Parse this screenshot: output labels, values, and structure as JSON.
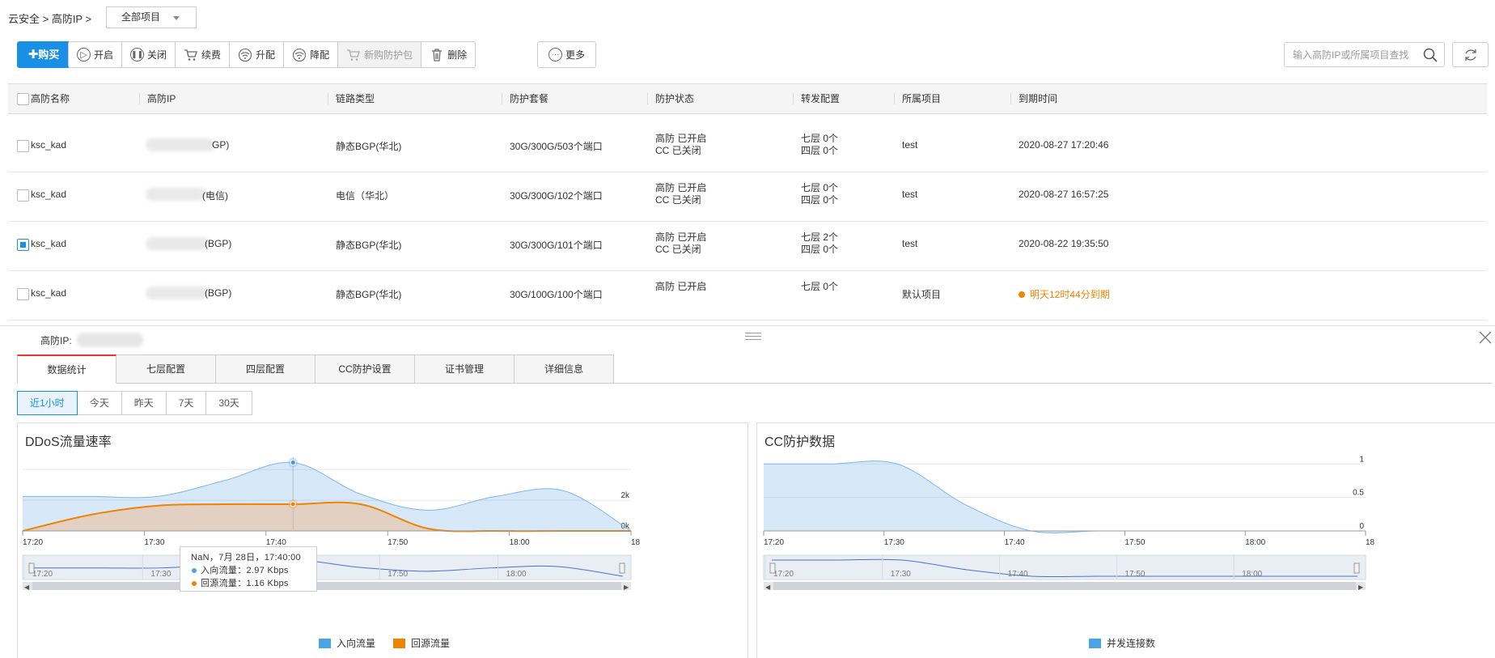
{
  "breadcrumb": "云安全 > 高防IP >",
  "project_select": "全部项目",
  "toolbar": {
    "buy": "购买",
    "group1": [
      {
        "label": "开启",
        "icon": "play-icon"
      },
      {
        "label": "关闭",
        "icon": "pause-icon"
      },
      {
        "label": "续费",
        "icon": "cart-icon"
      },
      {
        "label": "升配",
        "icon": "upgrade-icon"
      },
      {
        "label": "降配",
        "icon": "downgrade-icon"
      },
      {
        "label": "新购防护包",
        "icon": "cart-icon",
        "disabled": true
      },
      {
        "label": "删除",
        "icon": "trash-icon"
      }
    ],
    "more": "更多"
  },
  "search": {
    "placeholder": "输入高防IP或所属项目查找"
  },
  "table": {
    "headers": [
      "高防名称",
      "高防IP",
      "链路类型",
      "防护套餐",
      "防护状态",
      "转发配置",
      "所属项目",
      "到期时间"
    ],
    "rows": [
      {
        "checked": false,
        "name": "ksc_kad",
        "ip_suffix": "GP)",
        "link": "静态BGP(华北)",
        "package": "30G/300G/503个端口",
        "status1": "高防 已开启",
        "status2": "CC 已关闭",
        "fwd1": "七层 0个",
        "fwd2": "四层 0个",
        "project": "test",
        "expire": "2020-08-27 17:20:46"
      },
      {
        "checked": false,
        "name": "ksc_kad",
        "ip_suffix": "(电信)",
        "link": "电信（华北）",
        "package": "30G/300G/102个端口",
        "status1": "高防 已开启",
        "status2": "CC 已关闭",
        "fwd1": "七层 0个",
        "fwd2": "四层 0个",
        "project": "test",
        "expire": "2020-08-27 16:57:25"
      },
      {
        "checked": true,
        "name": "ksc_kad",
        "ip_suffix": "(BGP)",
        "link": "静态BGP(华北)",
        "package": "30G/300G/101个端口",
        "status1": "高防 已开启",
        "status2": "CC 已关闭",
        "fwd1": "七层 2个",
        "fwd2": "四层 0个",
        "project": "test",
        "expire": "2020-08-22 19:35:50"
      },
      {
        "checked": false,
        "name": "ksc_kad",
        "ip_suffix": "(BGP)",
        "link": "静态BGP(华北)",
        "package": "30G/100G/100个端口",
        "status1": "高防 已开启",
        "status2": "",
        "fwd1": "七层 0个",
        "fwd2": "",
        "project": "默认项目",
        "expire": "明天12时44分到期"
      }
    ]
  },
  "detail": {
    "title": "高防IP:",
    "tabs": [
      "数据统计",
      "七层配置",
      "四层配置",
      "CC防护设置",
      "证书管理",
      "详细信息"
    ],
    "ranges": [
      "近1小时",
      "今天",
      "昨天",
      "7天",
      "30天"
    ]
  },
  "charts": {
    "ddos_title": "DDoS流量速率",
    "cc_title": "CC防护数据",
    "tooltip": {
      "header": "NaN，7月 28日，17:40:00",
      "in": "入向流量：2.97 Kbps",
      "back": "回源流量：1.16 Kbps"
    },
    "ddos_legend": [
      "入向流量",
      "回源流量"
    ],
    "cc_legend": [
      "并发连接数"
    ]
  },
  "chart_data": [
    {
      "type": "area",
      "title": "DDoS流量速率",
      "x": [
        "17:20",
        "17:25",
        "17:30",
        "17:35",
        "17:40",
        "17:45",
        "17:50",
        "17:55",
        "18:00",
        "18:05"
      ],
      "x_ticks": [
        "17:20",
        "17:30",
        "17:40",
        "17:50",
        "18:00",
        "18"
      ],
      "y_ticks": [
        "0k",
        "2k"
      ],
      "ylim": [
        0,
        3200
      ],
      "series": [
        {
          "name": "入向流量",
          "color": "#7cb5ec",
          "values": [
            1500,
            1500,
            1500,
            2200,
            2970,
            1600,
            900,
            1500,
            1750,
            0
          ]
        },
        {
          "name": "回源流量",
          "color": "#f7a35c",
          "values": [
            0,
            700,
            1100,
            1160,
            1160,
            1160,
            100,
            0,
            0,
            0
          ]
        }
      ]
    },
    {
      "type": "area",
      "title": "CC防护数据",
      "x": [
        "17:20",
        "17:25",
        "17:30",
        "17:35",
        "17:40",
        "17:45",
        "17:50",
        "17:55",
        "18:00",
        "18:05"
      ],
      "x_ticks": [
        "17:20",
        "17:30",
        "17:40",
        "17:50",
        "18:00",
        "18"
      ],
      "y_ticks": [
        "0",
        "0.5",
        "1"
      ],
      "ylim": [
        0,
        1.1
      ],
      "series": [
        {
          "name": "并发连接数",
          "color": "#7cb5ec",
          "values": [
            1,
            1,
            1,
            0.4,
            0,
            0,
            0,
            0,
            0,
            0
          ]
        }
      ]
    }
  ],
  "colors": {
    "primary": "#1a8fe6",
    "warning": "#f08300",
    "tab_active": "#e33",
    "series_in": "#4aa3e8",
    "series_back": "#f08300"
  }
}
